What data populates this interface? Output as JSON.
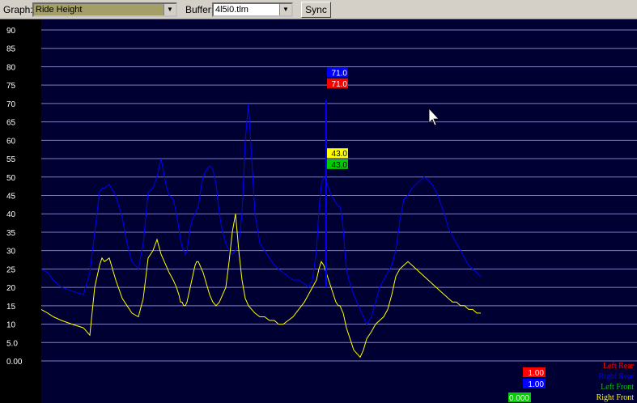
{
  "toolbar": {
    "graph_label": "Graph:",
    "graph_value": "Ride Height",
    "buffer_label": "Buffer:",
    "buffer_value": "4l5i0.tlm",
    "sync_label": "Sync"
  },
  "colors": {
    "plot_bg": "#000033",
    "grid": "#8080c0",
    "left_rear": "#ff0000",
    "right_rear": "#0000ff",
    "left_front": "#00cc00",
    "right_front": "#ffff00"
  },
  "chart_data": {
    "type": "line",
    "ylim": [
      0,
      90
    ],
    "ytick_labels": [
      "90",
      "85",
      "80",
      "75",
      "70",
      "65",
      "60",
      "55",
      "50",
      "45",
      "40",
      "35",
      "30",
      "25",
      "20",
      "15",
      "10",
      "5.0",
      "0.00"
    ],
    "grid": true,
    "legend_position": "bottom-right",
    "legend": [
      "Left Rear",
      "Right Rear",
      "Left Front",
      "Right Front"
    ],
    "x": [
      0,
      8,
      15,
      25,
      38,
      52,
      60,
      66,
      72,
      75,
      78,
      84,
      92,
      100,
      106,
      112,
      120,
      126,
      132,
      138,
      143,
      148,
      154,
      158,
      163,
      167,
      170,
      172,
      174,
      176,
      178,
      180,
      182,
      184,
      186,
      188,
      190,
      192,
      194,
      196,
      198,
      200,
      204,
      208,
      212,
      216,
      220,
      224,
      228,
      232,
      236,
      240,
      244,
      248,
      252,
      256,
      260,
      264,
      270,
      276,
      282,
      288,
      293,
      299,
      305,
      311,
      318,
      325,
      330,
      335,
      340,
      343,
      346,
      349,
      352,
      355,
      358,
      361,
      364,
      367,
      369,
      371,
      373,
      375,
      377,
      380,
      383,
      386,
      390,
      394,
      398,
      402,
      408,
      413,
      418,
      423,
      428,
      433,
      438,
      443,
      448,
      453,
      458,
      463,
      468,
      473,
      478,
      483,
      488,
      493,
      498,
      503,
      508,
      513,
      518,
      523,
      528,
      533,
      538,
      543,
      548,
      553,
      558,
      563,
      568,
      573,
      578,
      583,
      588,
      593,
      598,
      603,
      608,
      613,
      618,
      623,
      628,
      633,
      638,
      643,
      648,
      653,
      658,
      663,
      668,
      673,
      678,
      683,
      688,
      693,
      698,
      703,
      708,
      713,
      718,
      723,
      728,
      733,
      734
    ],
    "series": [
      {
        "name": "Right Rear",
        "values": [
          25,
          24,
          22,
          20,
          19,
          18,
          24,
          35,
          46,
          47,
          47,
          48,
          45,
          39,
          32,
          27,
          25,
          32,
          46,
          47,
          50,
          55,
          48,
          45,
          44,
          40,
          36,
          33,
          31,
          30,
          29,
          30,
          33,
          36,
          38,
          39,
          40,
          41,
          42,
          45,
          48,
          50,
          52,
          53,
          52,
          48,
          40,
          35,
          32,
          30,
          29,
          30,
          32,
          40,
          60,
          70,
          55,
          40,
          32,
          30,
          28,
          26,
          25,
          24,
          23,
          22,
          22,
          21,
          20,
          22,
          30,
          41,
          48,
          50,
          49,
          47,
          45,
          44,
          43,
          42,
          42,
          40,
          36,
          30,
          25,
          22,
          20,
          18,
          16,
          14,
          12,
          10,
          12,
          16,
          20,
          22,
          24,
          26,
          30,
          38,
          44,
          45,
          47,
          48,
          49,
          50,
          49,
          48,
          46,
          43,
          40,
          36,
          34,
          32,
          30,
          28,
          26,
          25,
          24,
          23
        ],
        "color": "#0000ff"
      },
      {
        "name": "Right Front",
        "values": [
          14,
          13,
          12,
          11,
          10,
          9,
          7,
          20,
          26,
          28,
          27,
          28,
          22,
          17,
          15,
          13,
          12,
          17,
          28,
          30,
          33,
          29,
          26,
          24,
          22,
          20,
          18,
          16,
          16,
          15,
          15,
          16,
          18,
          20,
          22,
          24,
          26,
          27,
          27,
          26,
          25,
          24,
          21,
          18,
          16,
          15,
          16,
          18,
          20,
          27,
          35,
          40,
          30,
          22,
          17,
          15,
          14,
          13,
          12,
          12,
          11,
          11,
          10,
          10,
          11,
          12,
          14,
          16,
          18,
          20,
          22,
          25,
          27,
          26,
          24,
          22,
          20,
          18,
          16,
          15,
          15,
          14,
          13,
          11,
          9,
          7,
          5,
          3,
          2,
          1,
          3,
          6,
          8,
          10,
          11,
          12,
          14,
          18,
          23,
          25,
          26,
          27,
          26,
          25,
          24,
          23,
          22,
          21,
          20,
          19,
          18,
          17,
          16,
          16,
          15,
          15,
          14,
          14,
          13,
          13
        ],
        "color": "#ffff00"
      }
    ],
    "cursor_markers": [
      {
        "series": "Right Rear",
        "value": "71.0",
        "color": "#0000ff"
      },
      {
        "series": "Left Rear",
        "value": "71.0",
        "color": "#ff0000"
      },
      {
        "series": "Right Front",
        "value": "43.0",
        "color": "#ffff00"
      },
      {
        "series": "Left Front",
        "value": "43.0",
        "color": "#00cc00"
      }
    ],
    "readouts": [
      {
        "value": "1.00",
        "color": "#ff0000"
      },
      {
        "value": "1.00",
        "color": "#0000ff"
      },
      {
        "value": "0.000",
        "color": "#00cc00"
      }
    ]
  }
}
